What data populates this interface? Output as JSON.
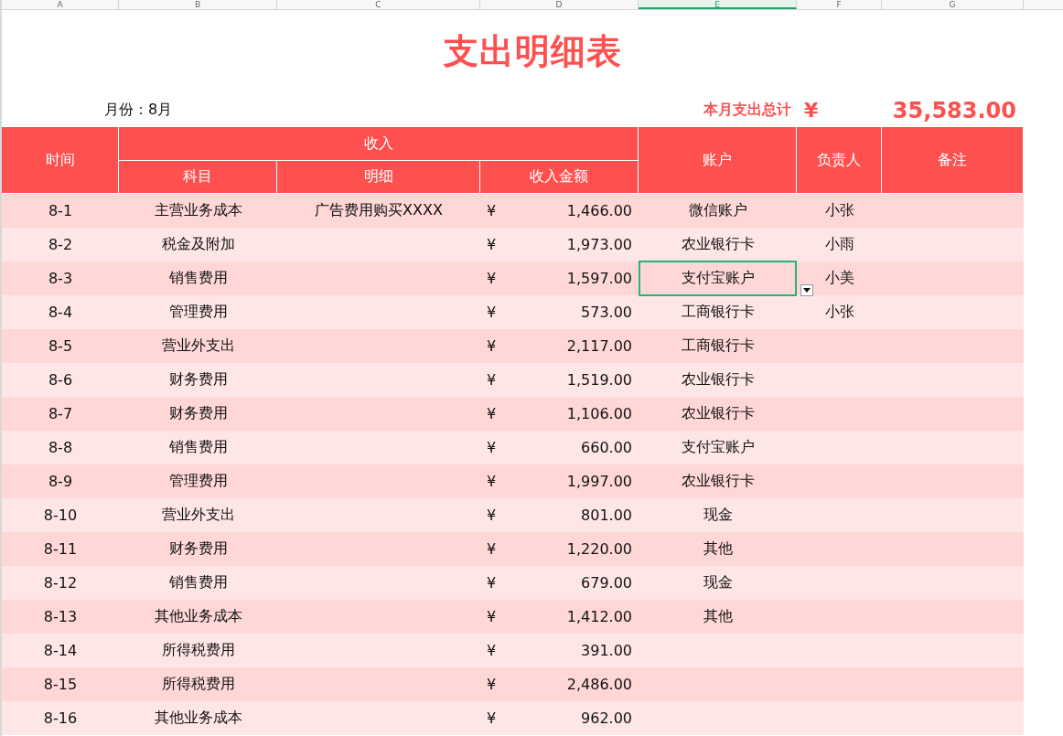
{
  "column_headers": [
    {
      "label": "A",
      "selected": false
    },
    {
      "label": "B",
      "selected": false
    },
    {
      "label": "C",
      "selected": false
    },
    {
      "label": "D",
      "selected": false
    },
    {
      "label": "E",
      "selected": true
    },
    {
      "label": "F",
      "selected": false
    },
    {
      "label": "G",
      "selected": false
    }
  ],
  "title": "支出明细表",
  "month": "月份：8月",
  "total_label": "本月支出总计",
  "total_currency": "¥",
  "total_amount": "35,583.00",
  "header": {
    "time": "时间",
    "group": "收入",
    "subject": "科目",
    "detail": "明细",
    "amount": "收入金额",
    "account": "账户",
    "owner": "负责人",
    "note": "备注"
  },
  "rows": [
    {
      "time": "8-1",
      "subject": "主营业务成本",
      "detail": "广告费用购买XXXX",
      "currency": "¥",
      "amount": "1,466.00",
      "account": "微信账户",
      "owner": "小张",
      "selected": false
    },
    {
      "time": "8-2",
      "subject": "税金及附加",
      "currency": "¥",
      "amount": "1,973.00",
      "account": "农业银行卡",
      "owner": "小雨",
      "selected": false
    },
    {
      "time": "8-3",
      "subject": "销售费用",
      "currency": "¥",
      "amount": "1,597.00",
      "account": "支付宝账户",
      "owner": "小美",
      "selected": true
    },
    {
      "time": "8-4",
      "subject": "管理费用",
      "currency": "¥",
      "amount": "573.00",
      "account": "工商银行卡",
      "owner": "小张",
      "selected": false
    },
    {
      "time": "8-5",
      "subject": "营业外支出",
      "currency": "¥",
      "amount": "2,117.00",
      "account": "工商银行卡",
      "selected": false
    },
    {
      "time": "8-6",
      "subject": "财务费用",
      "currency": "¥",
      "amount": "1,519.00",
      "account": "农业银行卡",
      "selected": false
    },
    {
      "time": "8-7",
      "subject": "财务费用",
      "currency": "¥",
      "amount": "1,106.00",
      "account": "农业银行卡",
      "selected": false
    },
    {
      "time": "8-8",
      "subject": "销售费用",
      "currency": "¥",
      "amount": "660.00",
      "account": "支付宝账户",
      "selected": false
    },
    {
      "time": "8-9",
      "subject": "管理费用",
      "currency": "¥",
      "amount": "1,997.00",
      "account": "农业银行卡",
      "selected": false
    },
    {
      "time": "8-10",
      "subject": "营业外支出",
      "currency": "¥",
      "amount": "801.00",
      "account": "现金",
      "selected": false
    },
    {
      "time": "8-11",
      "subject": "财务费用",
      "currency": "¥",
      "amount": "1,220.00",
      "account": "其他",
      "selected": false
    },
    {
      "time": "8-12",
      "subject": "销售费用",
      "currency": "¥",
      "amount": "679.00",
      "account": "现金",
      "selected": false
    },
    {
      "time": "8-13",
      "subject": "其他业务成本",
      "currency": "¥",
      "amount": "1,412.00",
      "account": "其他",
      "selected": false
    },
    {
      "time": "8-14",
      "subject": "所得税费用",
      "currency": "¥",
      "amount": "391.00",
      "selected": false
    },
    {
      "time": "8-15",
      "subject": "所得税费用",
      "currency": "¥",
      "amount": "2,486.00",
      "selected": false
    },
    {
      "time": "8-16",
      "subject": "其他业务成本",
      "currency": "¥",
      "amount": "962.00",
      "selected": false
    }
  ]
}
